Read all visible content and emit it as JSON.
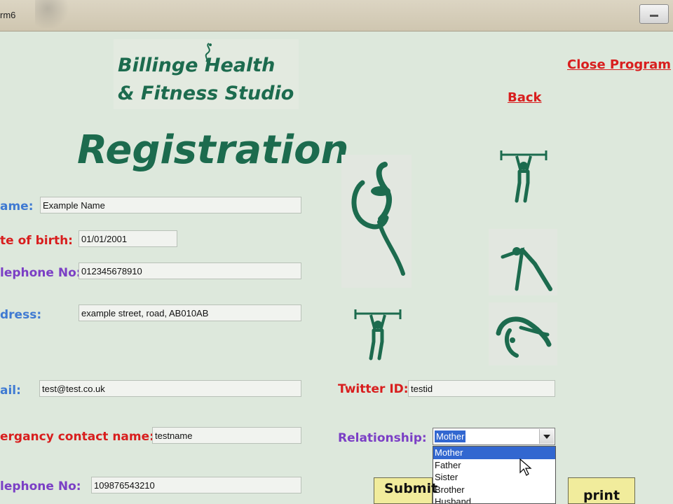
{
  "window": {
    "title": "rm6"
  },
  "logo": {
    "line1": "Billinge Health",
    "line2": "& Fitness Studio"
  },
  "links": {
    "close": "Close Program",
    "back": "Back"
  },
  "heading": "Registration",
  "form": {
    "name": {
      "label": "ame:",
      "value": "Example Name"
    },
    "dob": {
      "label": "te of birth:",
      "value": "01/01/2001"
    },
    "phone": {
      "label": "lephone No:",
      "value": "012345678910"
    },
    "address": {
      "label": "dress:",
      "value": "example street, road, AB010AB"
    },
    "email": {
      "label": "ail:",
      "value": "test@test.co.uk"
    },
    "twitter": {
      "label": "Twitter ID:",
      "value": "testid"
    },
    "emergency_name": {
      "label": "ergancy contact name:",
      "value": "testname"
    },
    "relationship": {
      "label": "Relationship:",
      "selected": "Mother",
      "options": [
        "Mother",
        "Father",
        "Sister",
        "Brother",
        "Husband"
      ]
    },
    "emergency_phone": {
      "label": "lephone No:",
      "value": "109876543210"
    }
  },
  "buttons": {
    "submit": "Submit",
    "print": "print"
  },
  "colors": {
    "brand_green": "#1c6b4e",
    "label_red": "#d81e1e",
    "label_blue": "#3f7ad2",
    "label_purple": "#7b3fc5",
    "button_yellow": "#f1ec9c"
  }
}
